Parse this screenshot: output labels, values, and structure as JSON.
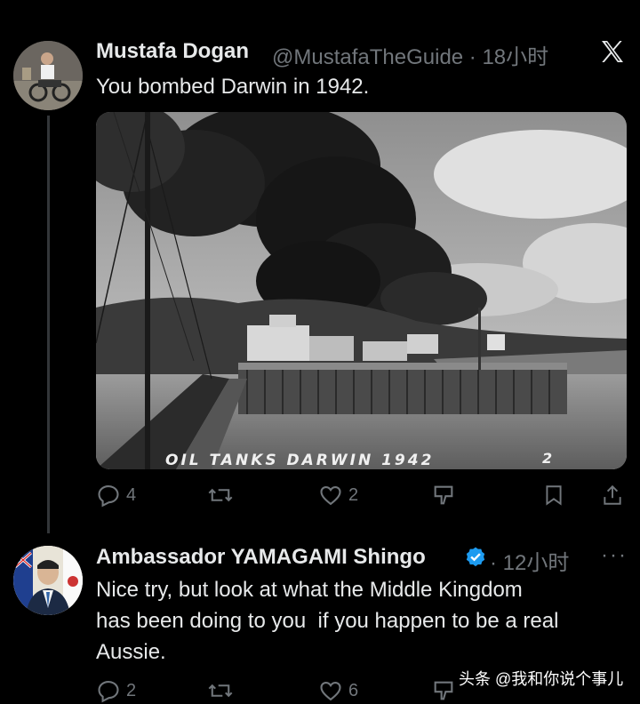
{
  "tweet1": {
    "display_name": "Mustafa Dogan",
    "handle_time": "@MustafaTheGuide · 18小时",
    "text": "You bombed Darwin in 1942.",
    "photo_caption_left": "OIL TANKS DARWIN 1942",
    "photo_caption_right": "2",
    "actions": {
      "replies": "4",
      "retweets": "",
      "likes": "2"
    }
  },
  "tweet2": {
    "display_name": "Ambassador YAMAGAMI Shingo",
    "time": "· 12小时",
    "text_lines": [
      "Nice try, but look at what the Middle Kingdom",
      "has been doing to you  if you happen to be a real",
      "Aussie."
    ],
    "actions": {
      "replies": "2",
      "retweets": "",
      "likes": "6"
    }
  },
  "watermark": "头条 @我和你说个事儿",
  "colors": {
    "background": "#000000",
    "text": "#e7e9ea",
    "muted": "#71767b",
    "verified": "#1d9bf0"
  },
  "icons": [
    "x-logo-icon",
    "reply-icon",
    "retweet-icon",
    "like-icon",
    "views-icon",
    "bookmark-icon",
    "share-icon",
    "verified-badge-icon",
    "more-icon"
  ]
}
